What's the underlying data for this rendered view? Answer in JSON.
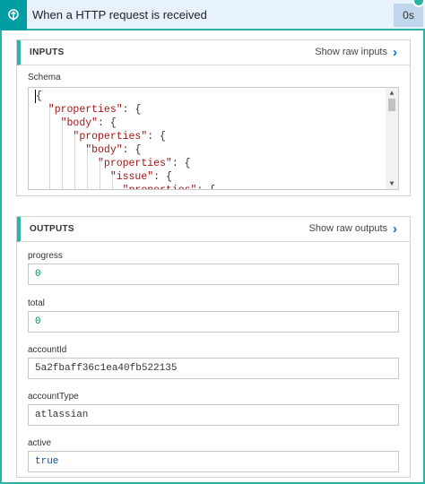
{
  "header": {
    "title": "When a HTTP request is received",
    "duration": "0s",
    "icon": "http-trigger-icon",
    "accent": "#009da5"
  },
  "inputs": {
    "title": "INPUTS",
    "raw_link": "Show raw inputs",
    "schema_label": "Schema",
    "schema_lines": [
      "{",
      "  \"properties\": {",
      "    \"body\": {",
      "      \"properties\": {",
      "        \"body\": {",
      "          \"properties\": {",
      "            \"issue\": {",
      "              \"properties\": {"
    ]
  },
  "outputs": {
    "title": "OUTPUTS",
    "raw_link": "Show raw outputs",
    "fields": [
      {
        "label": "progress",
        "value": "0"
      },
      {
        "label": "total",
        "value": "0"
      },
      {
        "label": "accountId",
        "value": "5a2fbaff36c1ea40fb522135"
      },
      {
        "label": "accountType",
        "value": "atlassian"
      },
      {
        "label": "active",
        "value": "true"
      }
    ]
  }
}
